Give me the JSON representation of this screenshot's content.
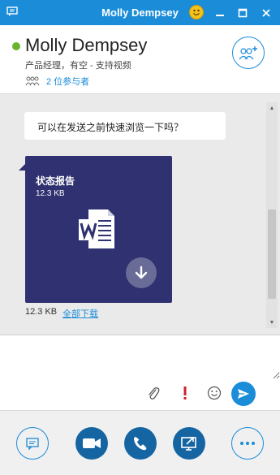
{
  "window": {
    "title": "Molly Dempsey",
    "controls": [
      "minimize",
      "maximize",
      "close"
    ]
  },
  "contact": {
    "name": "Molly Dempsey",
    "subtitle": "产品经理，有空 - 支持视频",
    "presence": "available",
    "participants_label": "2 位参与者"
  },
  "conversation": {
    "message_text": "可以在发送之前快速浏览一下吗？",
    "file": {
      "name": "状态报告",
      "size": "12.3 KB",
      "icon": "word-document-icon"
    },
    "total_size": "12.3 KB",
    "download_all_label": "全部下载"
  },
  "compose": {
    "placeholder": "",
    "tools": [
      "paperclip-icon",
      "importance-icon",
      "emoticon-icon",
      "send-icon"
    ]
  },
  "bottom_bar": {
    "buttons": [
      "im-icon",
      "video-icon",
      "call-icon",
      "present-icon",
      "more-icon"
    ]
  },
  "colors": {
    "accent": "#1a8cd8",
    "file_card": "#2f3170",
    "presence_available": "#6ab42d",
    "importance_red": "#d21f2b"
  }
}
